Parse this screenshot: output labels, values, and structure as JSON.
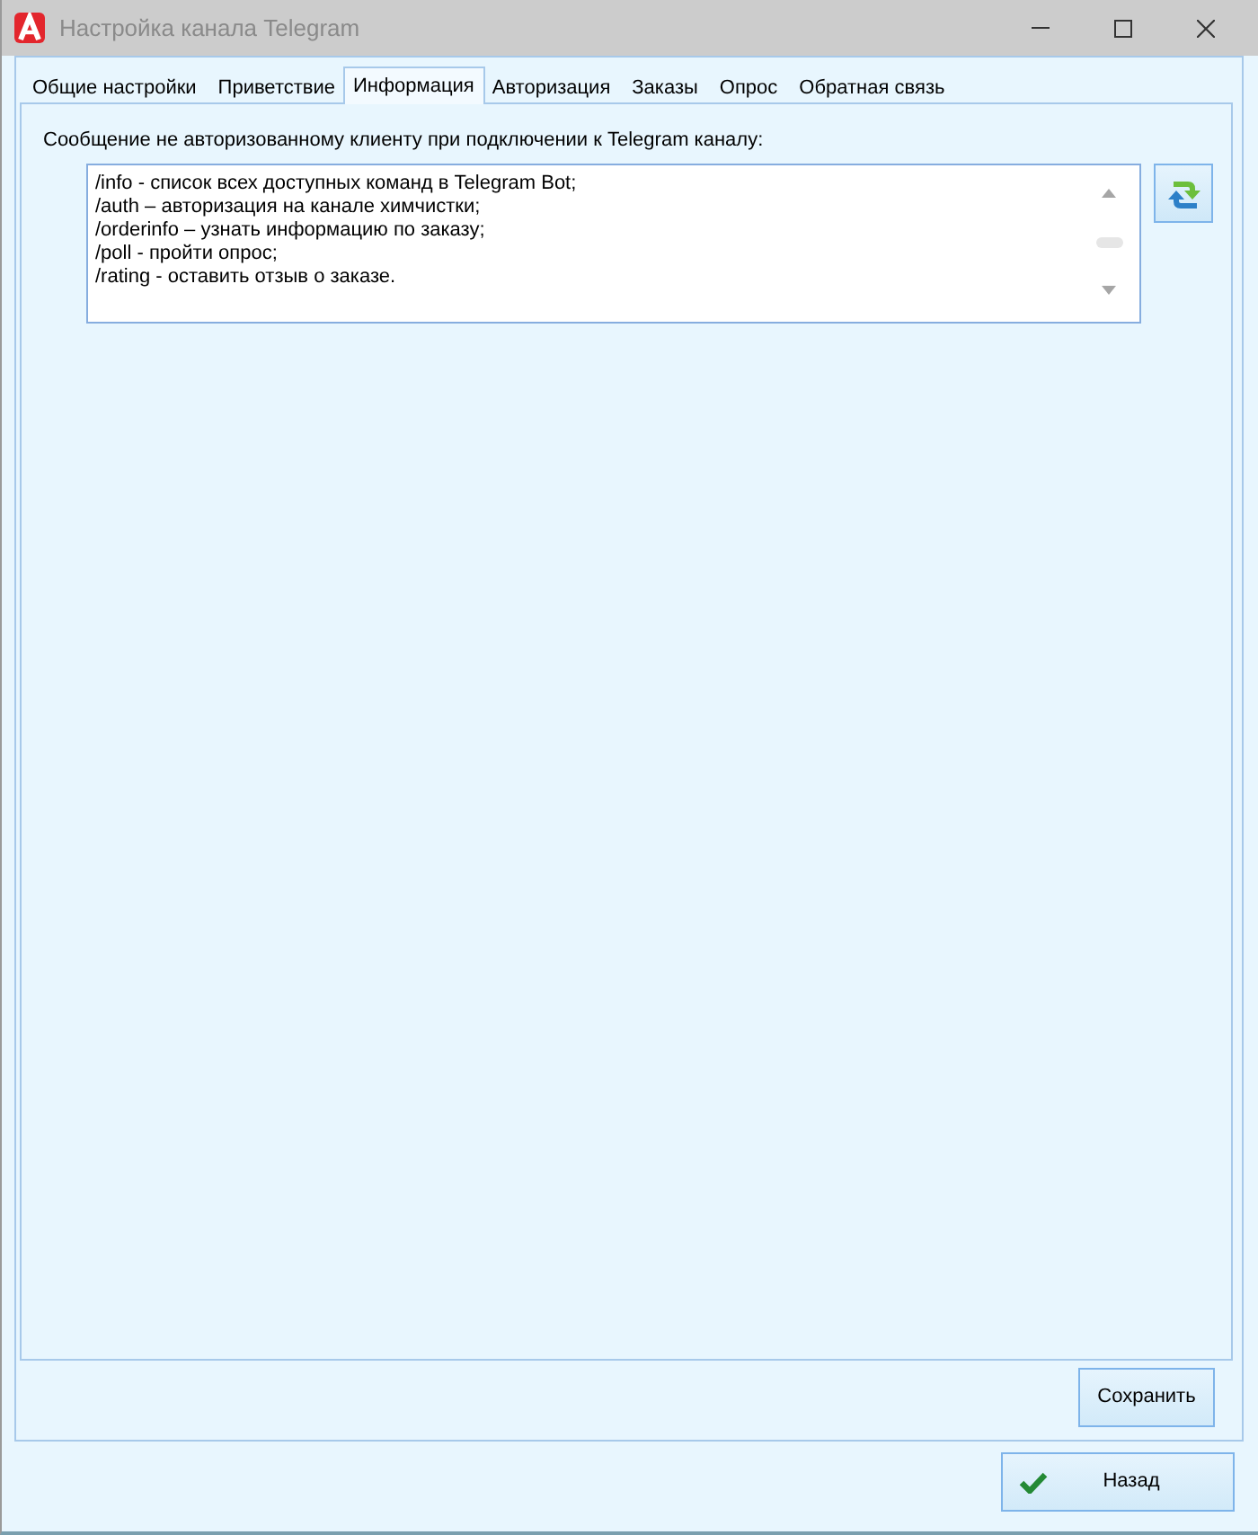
{
  "window": {
    "title": "Настройка канала Telegram"
  },
  "tabs": [
    {
      "label": "Общие настройки",
      "selected": false
    },
    {
      "label": "Приветствие",
      "selected": false
    },
    {
      "label": "Информация",
      "selected": true
    },
    {
      "label": "Авторизация",
      "selected": false
    },
    {
      "label": "Заказы",
      "selected": false
    },
    {
      "label": "Опрос",
      "selected": false
    },
    {
      "label": "Обратная связь",
      "selected": false
    }
  ],
  "info_tab": {
    "label": "Сообщение не авторизованному клиенту при подключении к Telegram каналу:",
    "message": {
      "lines": [
        "/info - список всех доступных команд в Telegram Bot;",
        "/auth – авторизация на канале химчистки;",
        "/orderinfo – узнать информацию по заказу;",
        "/poll - пройти опрос;",
        "/rating - оставить отзыв о заказе."
      ]
    }
  },
  "footer": {
    "save_button": "Сохранить",
    "back_button": "Назад"
  }
}
